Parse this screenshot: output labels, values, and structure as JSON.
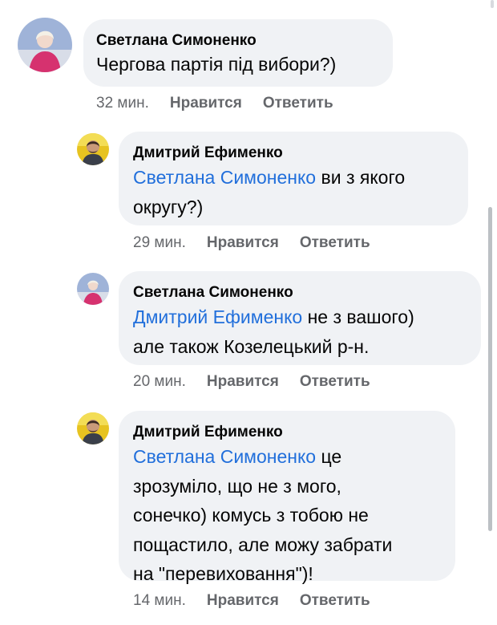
{
  "comments": [
    {
      "author": "Светлана Симоненко",
      "mention": "",
      "lines": [
        "Чергова партія під вибори?)"
      ],
      "time": "32 мин.",
      "like": "Нравится",
      "reply": "Ответить",
      "avatar_icon": "woman-avatar",
      "avatar_color": "#d6326f"
    },
    {
      "author": "Дмитрий Ефименко",
      "mention": "Светлана Симоненко",
      "lines": [
        " ви з якого",
        "округу?)"
      ],
      "time": "29 мин.",
      "like": "Нравится",
      "reply": "Ответить",
      "avatar_icon": "man-avatar",
      "avatar_color": "#e7c320"
    },
    {
      "author": "Светлана Симоненко",
      "mention": "Дмитрий Ефименко",
      "lines": [
        " не з вашого)",
        "але також Козелецький р-н."
      ],
      "time": "20 мин.",
      "like": "Нравится",
      "reply": "Ответить",
      "avatar_icon": "woman-avatar",
      "avatar_color": "#d6326f"
    },
    {
      "author": "Дмитрий Ефименко",
      "mention": "Светлана Симоненко",
      "lines": [
        " це",
        "зрозуміло, що не з мого,",
        "сонечко) комусь з тобою не",
        "пощастило, але можу забрати",
        "на \"перевиховання\")!"
      ],
      "time": "14 мин.",
      "like": "Нравится",
      "reply": "Ответить",
      "avatar_icon": "man-avatar",
      "avatar_color": "#e7c320"
    }
  ]
}
